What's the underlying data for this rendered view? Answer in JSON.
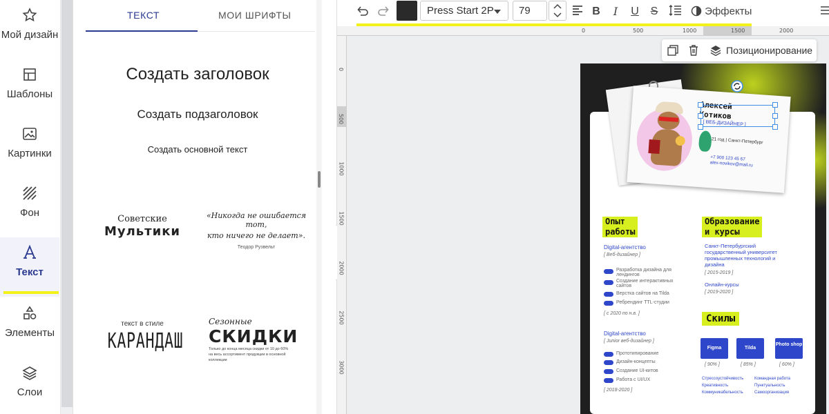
{
  "sidebar": {
    "items": [
      {
        "label": "Мой дизайн",
        "icon": "star-icon"
      },
      {
        "label": "Шаблоны",
        "icon": "template-icon"
      },
      {
        "label": "Картинки",
        "icon": "image-icon"
      },
      {
        "label": "Фон",
        "icon": "background-hatch-icon"
      },
      {
        "label": "Текст",
        "icon": "text-a-icon",
        "active": true
      },
      {
        "label": "Элементы",
        "icon": "shapes-icon"
      },
      {
        "label": "Слои",
        "icon": "layers-icon"
      }
    ]
  },
  "panel": {
    "tabs": [
      {
        "label": "ТЕКСТ",
        "active": true
      },
      {
        "label": "МОИ ШРИФТЫ"
      }
    ],
    "create_heading": "Создать заголовок",
    "create_subheading": "Создать подзаголовок",
    "create_body": "Создать основной текст",
    "presets": {
      "p1": {
        "line1": "Советские",
        "line2": "Мультики"
      },
      "p2": {
        "line1": "«Никогда не ошибается тот,",
        "line2": "кто ничего не делает».",
        "line3": "Теодор Рузвельт"
      },
      "p3": {
        "line1": "текст в стиле",
        "line2": "КАРАНДАШ"
      },
      "p4": {
        "line1": "Сезонные",
        "line2": "СКИДКИ",
        "line3": "Только до конца месяца скидки от 10 до 60%",
        "line4": "на весь ассортимент продукции в основной",
        "line5": "коллекции"
      }
    }
  },
  "toolbar": {
    "color": "#2a2a2a",
    "font": "Press Start 2P",
    "size": "79",
    "effects": "Эффекты"
  },
  "ruler": {
    "top": [
      "0",
      "500",
      "1000",
      "1500",
      "2000"
    ],
    "left": [
      "0",
      "500",
      "1000",
      "1500",
      "2000",
      "2500",
      "3000"
    ]
  },
  "floating": {
    "positioning": "Позиционирование"
  },
  "design": {
    "name_line1": "Алексей",
    "name_line2": "Котиков",
    "role": "[ ВЕБ-ДИЗАЙНЕР ]",
    "age_city": "21 год | Санкт-Петербург",
    "phone": "+7 900 123 45 67",
    "email": "alex-novikov@mail.ru",
    "exp_title_1": "Опыт",
    "exp_title_2": "работы",
    "edu_title_1": "Образование",
    "edu_title_2": "и курсы",
    "job1": "Digital-агентство",
    "job1_role": "[ Веб-дизайнер ]",
    "job1_items": [
      "Разработка дизайна для лендингов",
      "Создание интерактивных сайтов",
      "Верстка сайтов на Tilda",
      "Ребрендинг TTL-студии"
    ],
    "job1_period": "[ с 2020 по н.в. ]",
    "job2": "Digital-агентство",
    "job2_role": "[ Junior веб-дизайнер ]",
    "job2_items": [
      "Прототипирование",
      "Дизайн-концепты",
      "Создание UI-китов",
      "Работа с UI/UX"
    ],
    "job2_period": "[ 2018-2020 ]",
    "edu1": "Санкт-Петербургский государственный университет промышленных технологий и дизайна",
    "edu1_period": "[ 2015-2019 ]",
    "edu2": "Онлайн-курсы",
    "edu2_period": "[ 2019-2020 ]",
    "skills_title": "Скилы",
    "skills": [
      {
        "name": "Figma",
        "pct": "[ 90% ]"
      },
      {
        "name": "Tilda",
        "pct": "[ 85% ]"
      },
      {
        "name": "Photo shop",
        "pct": "[ 60% ]"
      }
    ],
    "skills_notes_1": [
      "Стрессоустойчивость",
      "Креативность",
      "Коммуникабельность"
    ],
    "skills_notes_2": [
      "Командная работа",
      "Пунктуальность",
      "Самоорганизация"
    ]
  }
}
